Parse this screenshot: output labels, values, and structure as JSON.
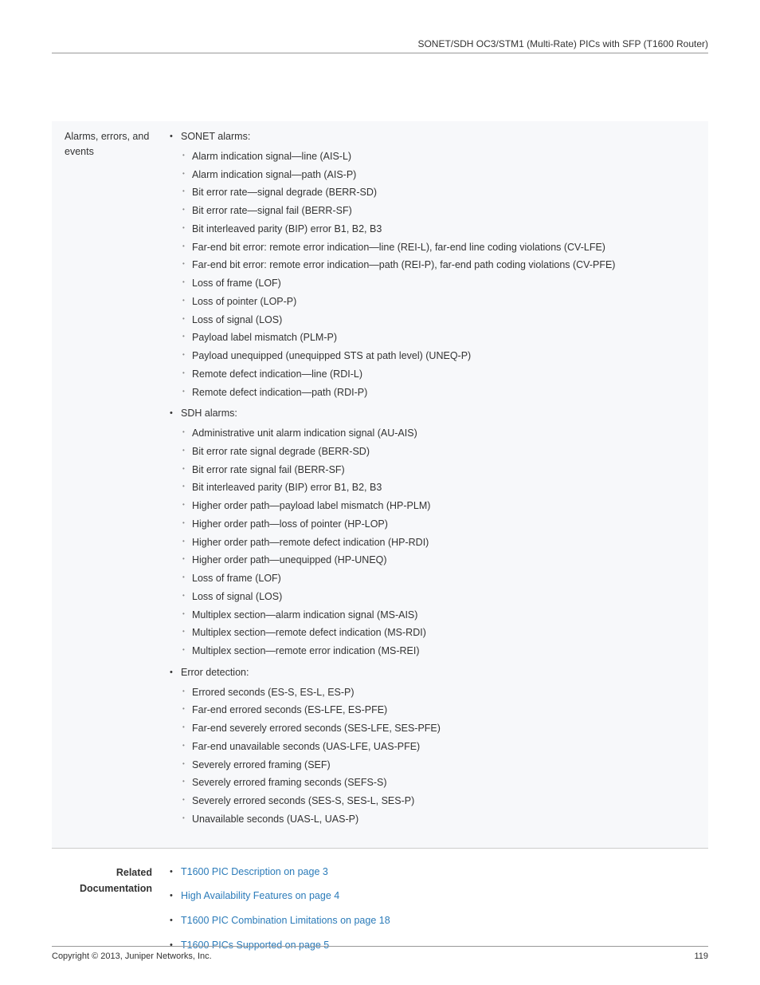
{
  "header": {
    "title": "SONET/SDH OC3/STM1 (Multi-Rate) PICs with SFP (T1600 Router)"
  },
  "spec": {
    "label": "Alarms, errors, and events",
    "sections": [
      {
        "title": "SONET alarms:",
        "items": [
          "Alarm indication signal—line (AIS-L)",
          "Alarm indication signal—path (AIS-P)",
          "Bit error rate—signal degrade (BERR-SD)",
          "Bit error rate—signal fail (BERR-SF)",
          "Bit interleaved parity (BIP) error B1, B2, B3",
          "Far-end bit error: remote error indication—line (REI-L), far-end line coding violations (CV-LFE)",
          "Far-end bit error: remote error indication—path (REI-P), far-end path coding violations (CV-PFE)",
          "Loss of frame (LOF)",
          "Loss of pointer (LOP-P)",
          "Loss of signal (LOS)",
          "Payload label mismatch (PLM-P)",
          "Payload unequipped (unequipped STS at path level) (UNEQ-P)",
          "Remote defect indication—line (RDI-L)",
          "Remote defect indication—path (RDI-P)"
        ]
      },
      {
        "title": "SDH alarms:",
        "items": [
          "Administrative unit alarm indication signal (AU-AIS)",
          "Bit error rate signal degrade (BERR-SD)",
          "Bit error rate signal fail (BERR-SF)",
          "Bit interleaved parity (BIP) error B1, B2, B3",
          "Higher order path—payload label mismatch (HP-PLM)",
          "Higher order path—loss of pointer (HP-LOP)",
          "Higher order path—remote defect indication (HP-RDI)",
          "Higher order path—unequipped (HP-UNEQ)",
          "Loss of frame (LOF)",
          "Loss of signal (LOS)",
          "Multiplex section—alarm indication signal (MS-AIS)",
          "Multiplex section—remote defect indication (MS-RDI)",
          "Multiplex section—remote error indication (MS-REI)"
        ]
      },
      {
        "title": "Error detection:",
        "items": [
          "Errored seconds (ES-S, ES-L, ES-P)",
          "Far-end errored seconds (ES-LFE, ES-PFE)",
          "Far-end severely errored seconds (SES-LFE, SES-PFE)",
          "Far-end unavailable seconds (UAS-LFE, UAS-PFE)",
          "Severely errored framing (SEF)",
          "Severely errored framing seconds (SEFS-S)",
          "Severely errored seconds (SES-S, SES-L, SES-P)",
          "Unavailable seconds (UAS-L, UAS-P)"
        ]
      }
    ]
  },
  "related": {
    "label_line1": "Related",
    "label_line2": "Documentation",
    "links": [
      "T1600 PIC Description on page 3",
      "High Availability Features on page 4",
      "T1600 PIC Combination Limitations on page 18",
      "T1600 PICs Supported on page 5"
    ]
  },
  "footer": {
    "copyright": "Copyright © 2013, Juniper Networks, Inc.",
    "page": "119"
  }
}
